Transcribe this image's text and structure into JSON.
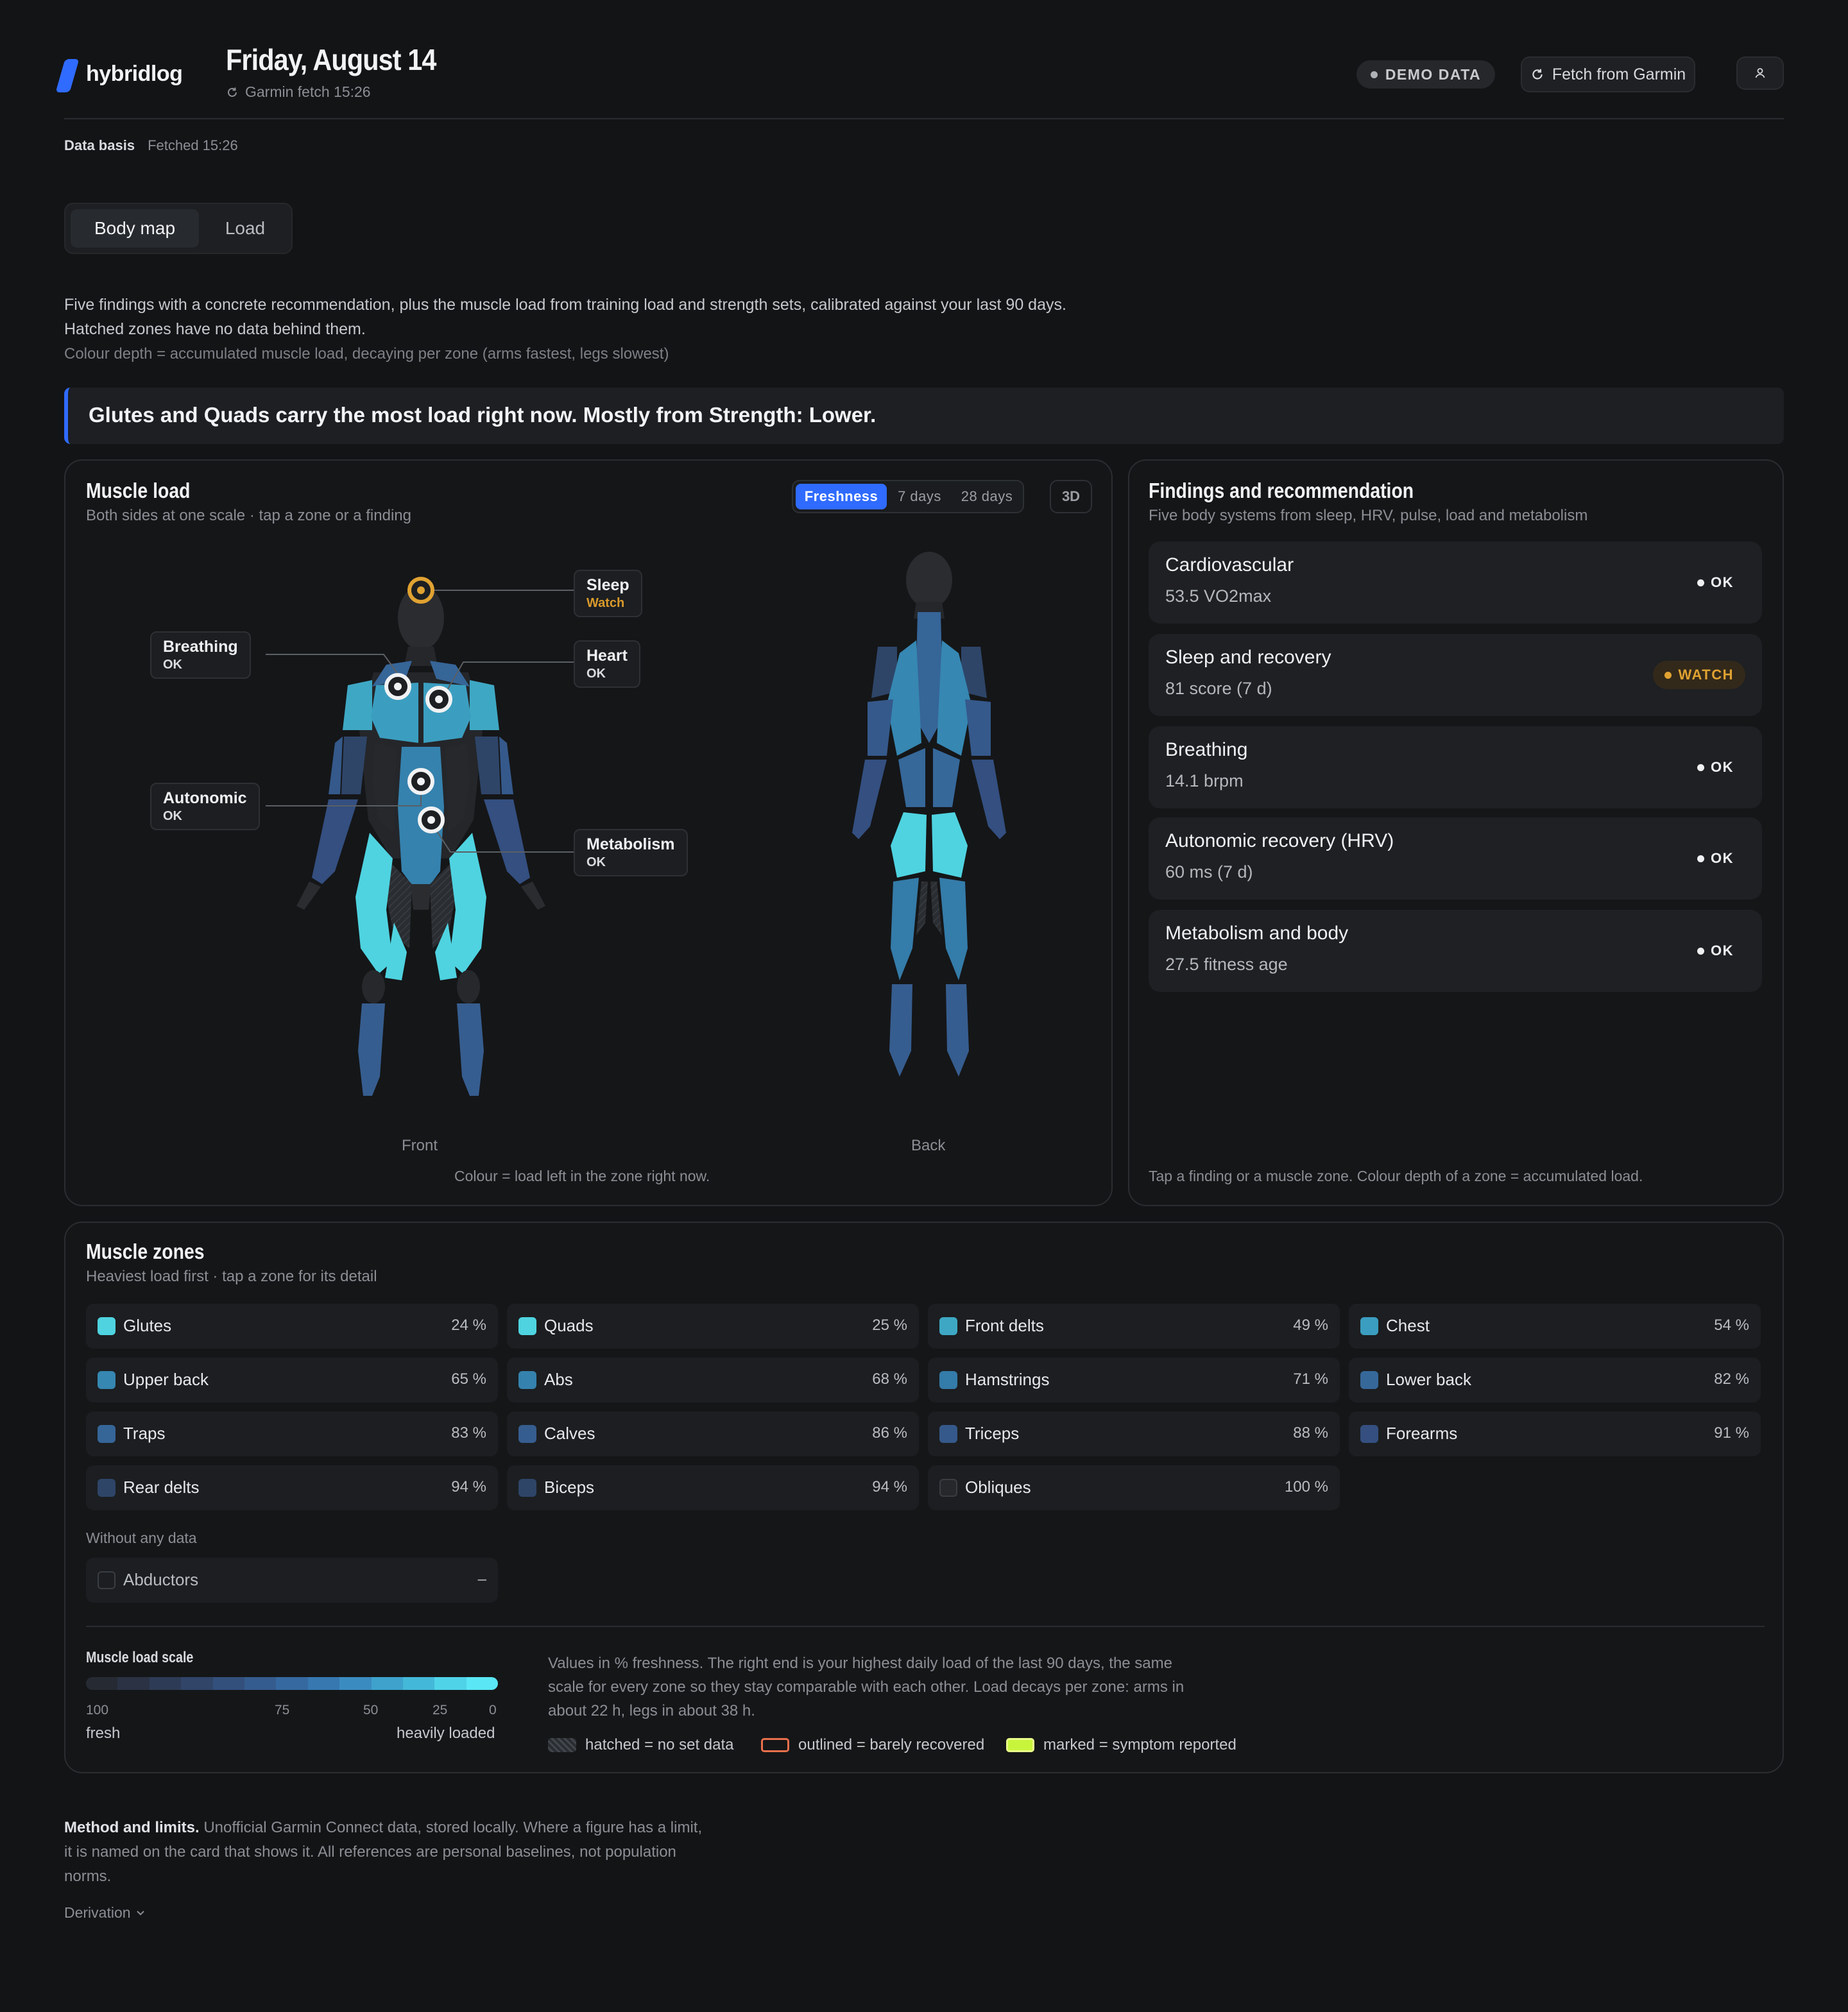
{
  "app": {
    "name": "hybridlog"
  },
  "header": {
    "title": "Friday, August 14",
    "fetch_status": "Garmin fetch 15:26",
    "demo_badge": "DEMO DATA",
    "fetch_button": "Fetch from Garmin"
  },
  "data_basis": {
    "label": "Data basis",
    "value": "Fetched 15:26"
  },
  "view_tabs": [
    {
      "label": "Body map",
      "selected": true
    },
    {
      "label": "Load",
      "selected": false
    }
  ],
  "intro": {
    "line1": "Five findings with a concrete recommendation, plus the muscle load from training load and strength sets, calibrated against your last 90 days.",
    "line2": "Hatched zones have no data behind them.",
    "line3": "Colour depth = accumulated muscle load, decaying per zone (arms fastest, legs slowest)"
  },
  "headline": "Glutes and Quads carry the most load right now. Mostly from Strength: Lower.",
  "muscle_load": {
    "title": "Muscle load",
    "subtitle": "Both sides at one scale · tap a zone or a finding",
    "range_options": [
      "Freshness",
      "7 days",
      "28 days"
    ],
    "selected_range": "Freshness",
    "view_3d": "3D",
    "front_label": "Front",
    "back_label": "Back",
    "caption": "Colour = load left in the zone right now.",
    "callouts": {
      "sleep": {
        "title": "Sleep",
        "status": "Watch"
      },
      "breathing": {
        "title": "Breathing",
        "status": "OK"
      },
      "heart": {
        "title": "Heart",
        "status": "OK"
      },
      "autonomic": {
        "title": "Autonomic",
        "status": "OK"
      },
      "metabolism": {
        "title": "Metabolism",
        "status": "OK"
      }
    }
  },
  "findings": {
    "title": "Findings and recommendation",
    "subtitle": "Five body systems from sleep, HRV, pulse, load and metabolism",
    "items": [
      {
        "title": "Cardiovascular",
        "value": "53.5 VO2max",
        "status": "OK"
      },
      {
        "title": "Sleep and recovery",
        "value": "81 score (7 d)",
        "status": "WATCH"
      },
      {
        "title": "Breathing",
        "value": "14.1 brpm",
        "status": "OK"
      },
      {
        "title": "Autonomic recovery (HRV)",
        "value": "60 ms (7 d)",
        "status": "OK"
      },
      {
        "title": "Metabolism and body",
        "value": "27.5 fitness age",
        "status": "OK"
      }
    ],
    "footer": "Tap a finding or a muscle zone. Colour depth of a zone = accumulated load."
  },
  "zones": {
    "title": "Muscle zones",
    "subtitle": "Heaviest load first · tap a zone for its detail",
    "items": [
      {
        "name": "Glutes",
        "value": "24 %",
        "color": "#4fd3e0"
      },
      {
        "name": "Quads",
        "value": "25 %",
        "color": "#4fd3e0"
      },
      {
        "name": "Front delts",
        "value": "49 %",
        "color": "#3ea8c4"
      },
      {
        "name": "Chest",
        "value": "54 %",
        "color": "#3b9ec0"
      },
      {
        "name": "Upper back",
        "value": "65 %",
        "color": "#3687b2"
      },
      {
        "name": "Abs",
        "value": "68 %",
        "color": "#3582ae"
      },
      {
        "name": "Hamstrings",
        "value": "71 %",
        "color": "#347ca9"
      },
      {
        "name": "Lower back",
        "value": "82 %",
        "color": "#36689a"
      },
      {
        "name": "Traps",
        "value": "83 %",
        "color": "#366598"
      },
      {
        "name": "Calves",
        "value": "86 %",
        "color": "#365d8f"
      },
      {
        "name": "Triceps",
        "value": "88 %",
        "color": "#35598b"
      },
      {
        "name": "Forearms",
        "value": "91 %",
        "color": "#344f80"
      },
      {
        "name": "Rear delts",
        "value": "94 %",
        "color": "#2e4568"
      },
      {
        "name": "Biceps",
        "value": "94 %",
        "color": "#2e4568"
      },
      {
        "name": "Obliques",
        "value": "100 %",
        "color": "#26282c"
      }
    ],
    "no_data_label": "Without any data",
    "no_data_items": [
      {
        "name": "Abductors",
        "value": "–"
      }
    ],
    "scale": {
      "title": "Muscle load scale",
      "ticks": [
        "100",
        "75",
        "50",
        "25",
        "0"
      ],
      "left_label": "fresh",
      "right_label": "heavily loaded",
      "note": "Values in % freshness. The right end is your highest daily load of the last 90 days, the same scale for every zone so they stay comparable with each other. Load decays per zone: arms in about 22 h, legs in about 38 h."
    },
    "legend": {
      "hatched": "hatched = no set data",
      "outlined": "outlined = barely recovered",
      "marked": "marked = symptom reported",
      "outlined_color": "#e8704c",
      "marked_color": "#c8f53c"
    }
  },
  "method": {
    "lead": "Method and limits.",
    "text": "Unofficial Garmin Connect data, stored locally. Where a figure has a limit, it is named on the card that shows it. All references are personal baselines, not population norms.",
    "derivation": "Derivation"
  },
  "colors": {
    "accent": "#2f6bff",
    "watch": "#e0a231",
    "background": "#131416"
  }
}
